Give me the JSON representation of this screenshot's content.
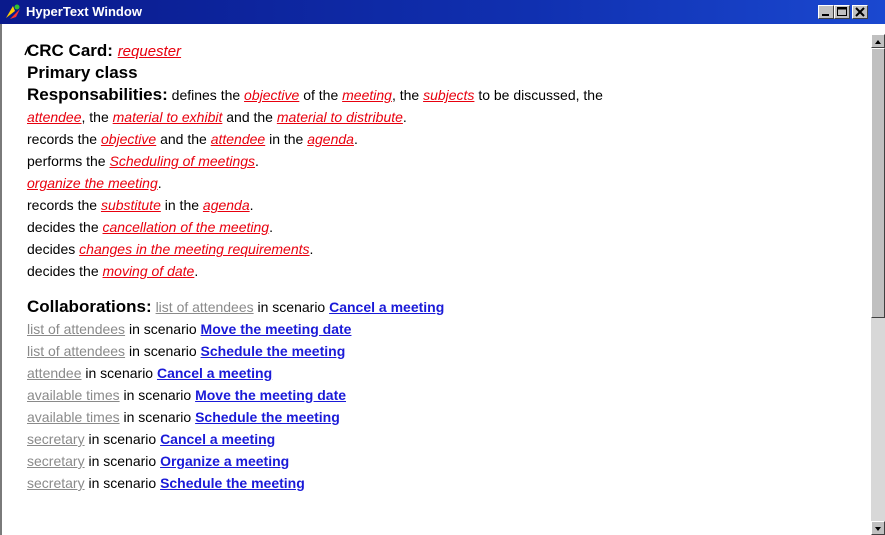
{
  "window": {
    "title": "HyperText Window",
    "controls": {
      "minimize": "minimize-icon",
      "maximize": "maximize-icon",
      "close": "close-icon"
    }
  },
  "card": {
    "label": "CRC Card:",
    "name": "requester",
    "class_type": "Primary class"
  },
  "responsabilities": {
    "label": "Responsabilities:",
    "lines": [
      [
        {
          "t": "text",
          "v": " defines the "
        },
        {
          "t": "red",
          "v": "objective"
        },
        {
          "t": "text",
          "v": " of the "
        },
        {
          "t": "red",
          "v": "meeting"
        },
        {
          "t": "text",
          "v": ", the "
        },
        {
          "t": "red",
          "v": "subjects"
        },
        {
          "t": "text",
          "v": " to be discussed, the"
        }
      ],
      [
        {
          "t": "red",
          "v": "attendee"
        },
        {
          "t": "text",
          "v": ", the "
        },
        {
          "t": "red",
          "v": "material to exhibit"
        },
        {
          "t": "text",
          "v": " and the "
        },
        {
          "t": "red",
          "v": "material to distribute"
        },
        {
          "t": "text",
          "v": "."
        }
      ],
      [
        {
          "t": "text",
          "v": "records the "
        },
        {
          "t": "red",
          "v": "objective"
        },
        {
          "t": "text",
          "v": " and the "
        },
        {
          "t": "red",
          "v": "attendee"
        },
        {
          "t": "text",
          "v": " in the "
        },
        {
          "t": "red",
          "v": "agenda"
        },
        {
          "t": "text",
          "v": "."
        }
      ],
      [
        {
          "t": "text",
          "v": "performs the "
        },
        {
          "t": "red",
          "v": "Scheduling  of meetings"
        },
        {
          "t": "text",
          "v": "."
        }
      ],
      [
        {
          "t": "red",
          "v": "organize the meeting"
        },
        {
          "t": "text",
          "v": "."
        }
      ],
      [
        {
          "t": "text",
          "v": "records the "
        },
        {
          "t": "red",
          "v": "substitute"
        },
        {
          "t": "text",
          "v": " in the "
        },
        {
          "t": "red",
          "v": "agenda"
        },
        {
          "t": "text",
          "v": "."
        }
      ],
      [
        {
          "t": "text",
          "v": "decides the "
        },
        {
          "t": "red",
          "v": "cancellation of the meeting"
        },
        {
          "t": "text",
          "v": "."
        }
      ],
      [
        {
          "t": "text",
          "v": "decides "
        },
        {
          "t": "red",
          "v": "changes in the meeting requirements"
        },
        {
          "t": "text",
          "v": "."
        }
      ],
      [
        {
          "t": "text",
          "v": "decides the "
        },
        {
          "t": "red",
          "v": "moving of date"
        },
        {
          "t": "text",
          "v": "."
        }
      ]
    ]
  },
  "collaborations": {
    "label": "Collaborations:",
    "connector": " in scenario ",
    "items": [
      {
        "object": "list of attendees",
        "scenario": "Cancel a meeting"
      },
      {
        "object": "list of attendees",
        "scenario": "Move the meeting date"
      },
      {
        "object": "list of attendees",
        "scenario": "Schedule the meeting"
      },
      {
        "object": "attendee",
        "scenario": "Cancel a meeting"
      },
      {
        "object": "available times",
        "scenario": "Move the meeting date"
      },
      {
        "object": "available times",
        "scenario": "Schedule the meeting"
      },
      {
        "object": "secretary",
        "scenario": "Cancel a meeting"
      },
      {
        "object": "secretary",
        "scenario": "Organize a meeting "
      },
      {
        "object": "secretary",
        "scenario": "Schedule the meeting"
      }
    ]
  },
  "colors": {
    "title_bar": "#0a1a8c",
    "red_link": "#e8000e",
    "gray_link": "#8a8a8a",
    "blue_link": "#1a1ad8"
  }
}
